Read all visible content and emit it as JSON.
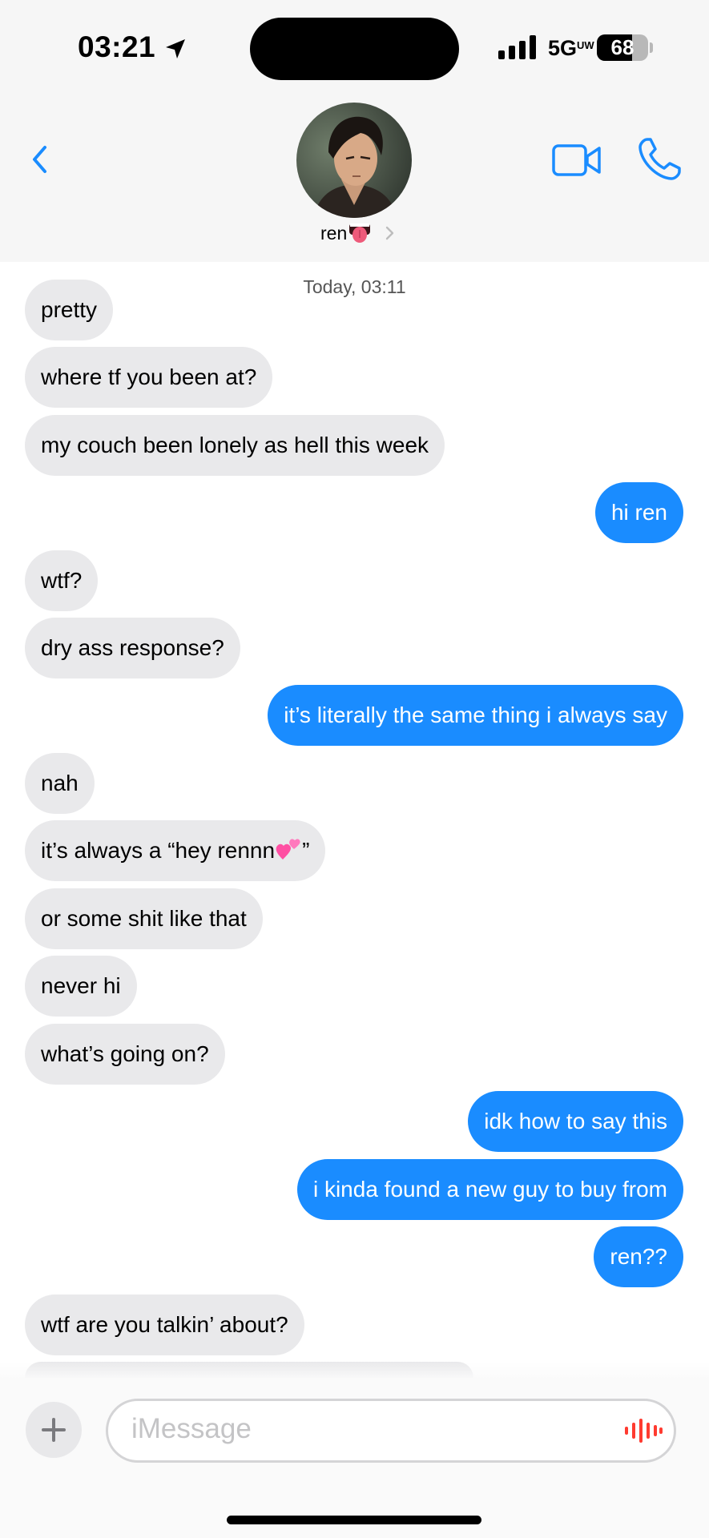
{
  "status_bar": {
    "time": "03:21",
    "network": "5G",
    "network_sup": "UW",
    "battery_percent": "68",
    "battery_level": 0.68,
    "signal_bars": 4
  },
  "header": {
    "contact_name": "ren",
    "icons": {
      "back": "chevron-left-icon",
      "video": "video-camera-icon",
      "phone": "phone-icon",
      "tongue_emoji": "tongue-emoji"
    }
  },
  "conversation": {
    "timestamp_day": "Today,",
    "timestamp_time": "03:11",
    "messages": [
      {
        "from": "them",
        "text": "pretty"
      },
      {
        "from": "them",
        "text": "where tf you been at?"
      },
      {
        "from": "them",
        "text": "my couch been lonely as hell this week"
      },
      {
        "from": "me",
        "text": "hi ren"
      },
      {
        "from": "them",
        "text": "wtf?"
      },
      {
        "from": "them",
        "text": "dry ass response?"
      },
      {
        "from": "me",
        "text": "it’s literally the same thing i always say"
      },
      {
        "from": "them",
        "text": "nah"
      },
      {
        "from": "them",
        "text_before": "it’s always a “hey rennn",
        "text_after": "”",
        "emoji": "two-hearts-emoji"
      },
      {
        "from": "them",
        "text": "or some shit like that"
      },
      {
        "from": "them",
        "text": "never hi"
      },
      {
        "from": "them",
        "text": "what’s going on?"
      },
      {
        "from": "me",
        "text": "idk how to say this"
      },
      {
        "from": "me",
        "text": "i kinda found a new guy to buy from"
      },
      {
        "from": "me",
        "text": "ren??"
      },
      {
        "from": "them",
        "text": "wtf are you talkin’ about?"
      }
    ]
  },
  "composer": {
    "placeholder": "iMessage",
    "icons": {
      "add": "plus-icon",
      "voice": "waveform-icon"
    }
  },
  "colors": {
    "accent": "#1a8cff",
    "incoming_bubble": "#e9e9eb",
    "header_bg": "#f6f6f6",
    "waveform": "#ff3b30"
  }
}
